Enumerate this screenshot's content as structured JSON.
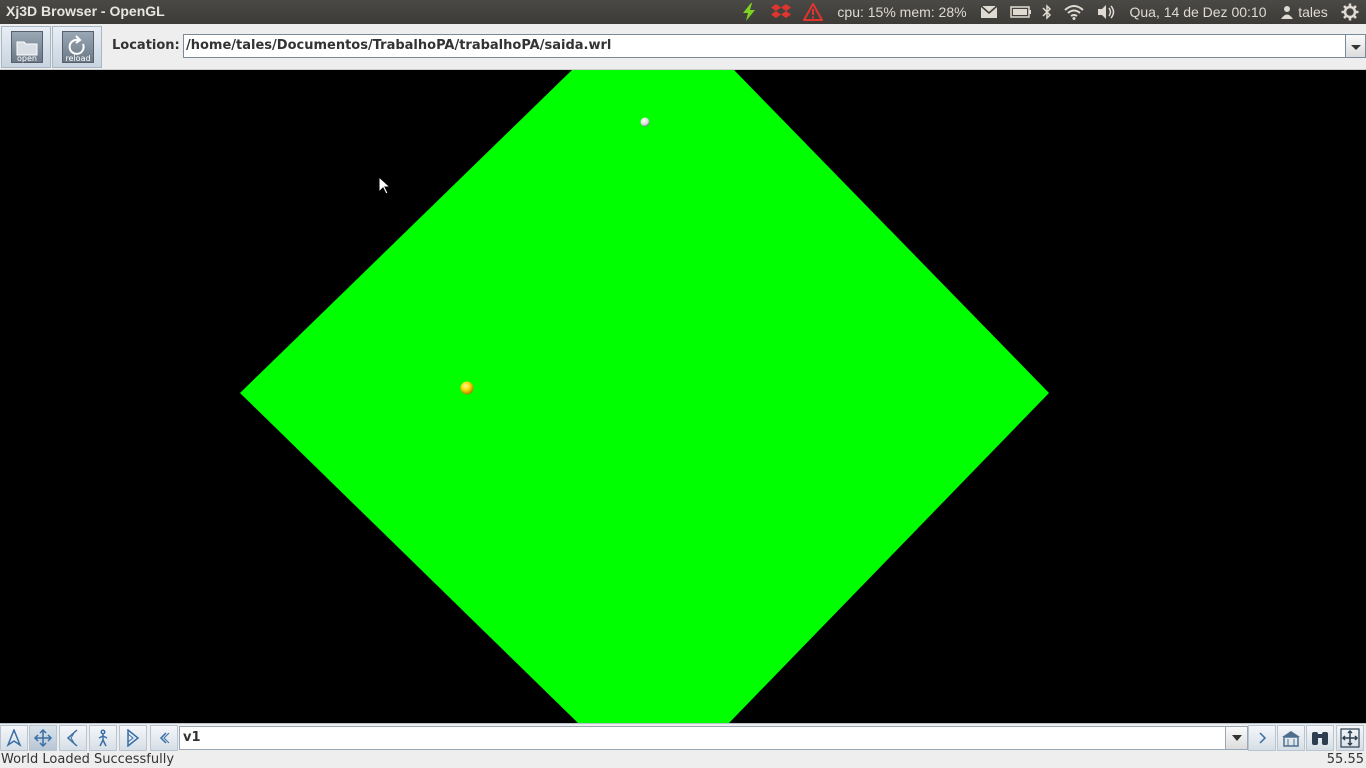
{
  "window": {
    "title": "Xj3D Browser - OpenGL"
  },
  "panel": {
    "cpu_mem": "cpu: 15% mem: 28%",
    "datetime": "Qua, 14 de Dez 00:10",
    "user": "tales",
    "icons": [
      "power-icon",
      "dropbox-icon",
      "warning-icon",
      "mail-icon",
      "battery-icon",
      "bluetooth-icon",
      "wifi-icon",
      "volume-icon",
      "user-icon",
      "settings-gear-icon"
    ]
  },
  "toolbar": {
    "open_label": "open",
    "reload_label": "reload",
    "location_label": "Location:",
    "location_value": "/home/tales/Documentos/TrabalhoPA/trabalhoPA/saida.wrl"
  },
  "scene": {
    "background": "#000000",
    "floor_color": "#00ff00",
    "sphere_colors": [
      "#ffffff",
      "#ffd700"
    ]
  },
  "navbar": {
    "viewpoint_value": "v1",
    "buttons": [
      "fly-icon",
      "pan-icon",
      "tilt-icon",
      "walk-icon",
      "examine-icon",
      "previous-viewpoint-icon",
      "viewpoint-dropdown-icon",
      "next-viewpoint-icon",
      "home-viewpoint-icon",
      "lookat-icon",
      "fit-view-icon"
    ]
  },
  "status": {
    "message": "World Loaded Successfully",
    "fps": "55.55"
  }
}
